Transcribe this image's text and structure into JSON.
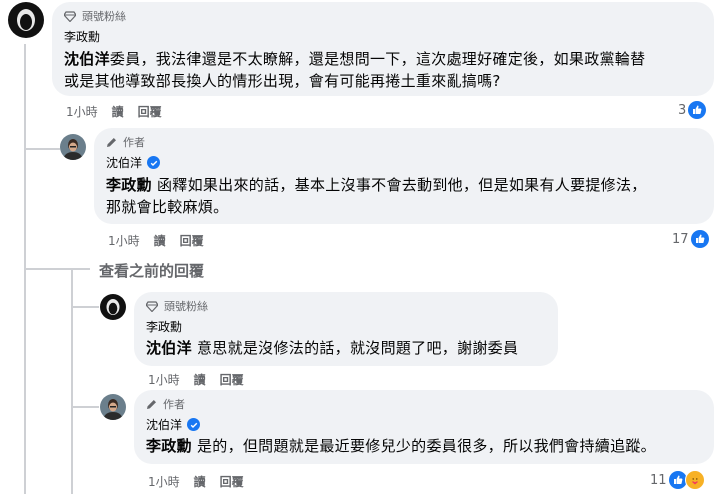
{
  "comments": [
    {
      "badge": "頭號粉絲",
      "author": "李政勳",
      "mention": "沈伯洋",
      "lines": [
        "委員，我法律還是不太瞭解，還是想問一下，這次處理好確定後，如果政黨輪替",
        "或是其他導致部長換人的情形出現，會有可能再捲土重來亂搞嗎?"
      ],
      "time": "1小時",
      "read": "讀",
      "reply": "回覆",
      "reactions": "3"
    },
    {
      "badge": "作者",
      "author": "沈伯洋",
      "mention": "李政勳",
      "lines": [
        "函釋如果出來的話，基本上沒事不會去動到他，但是如果有人要提修法，",
        "那就會比較麻煩。"
      ],
      "time": "1小時",
      "read": "讀",
      "reply": "回覆",
      "reactions": "17"
    },
    {
      "badge": "頭號粉絲",
      "author": "李政勳",
      "mention": "沈伯洋",
      "lines": [
        "意思就是沒修法的話，就沒問題了吧，謝謝委員"
      ],
      "time": "1小時",
      "read": "讀",
      "reply": "回覆",
      "reactions": ""
    },
    {
      "badge": "作者",
      "author": "沈伯洋",
      "mention": "李政勳",
      "lines": [
        "是的，但問題就是最近要修兒少的委員很多，所以我們會持續追蹤。"
      ],
      "time": "1小時",
      "read": "讀",
      "reply": "回覆",
      "reactions": "11"
    }
  ],
  "view_previous": "查看之前的回覆",
  "colors": {
    "accent": "#1877f2",
    "bubble": "#f0f2f5",
    "meta": "#65676b"
  },
  "icons": [
    "diamond-icon",
    "pencil-icon",
    "verified-icon",
    "like-icon",
    "care-icon"
  ]
}
